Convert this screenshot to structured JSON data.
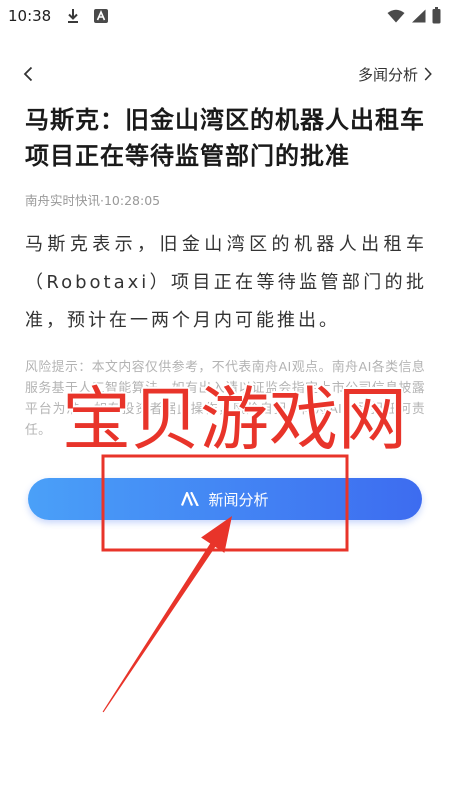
{
  "status_bar": {
    "time": "10:38",
    "left_icons": [
      "download-icon",
      "app-a-icon"
    ],
    "right_icons": [
      "wifi-icon",
      "signal-icon",
      "battery-icon"
    ]
  },
  "header": {
    "back_icon": "chevron-left-icon",
    "analysis_link": "多闻分析",
    "analysis_link_icon": "chevron-right-icon"
  },
  "article": {
    "title": "马斯克：旧金山湾区的机器人出租车项目正在等待监管部门的批准",
    "source_line": "南舟实时快讯·10:28:05",
    "body": "马斯克表示，旧金山湾区的机器人出租车（Robotaxi）项目正在等待监管部门的批准，预计在一两个月内可能推出。",
    "disclaimer": "风险提示：本文内容仅供参考，不代表南舟AI观点。南舟AI各类信息服务基于人工智能算法，如有出入请以证监会指定上市公司信息披露平台为准。如有投资者据此操作，风险自担，南舟AI不承担任何责任。"
  },
  "action_button": {
    "label": "新闻分析",
    "icon": "ai-logo-icon"
  },
  "watermark": {
    "text": "宝贝游戏网"
  },
  "colors": {
    "title": "#1a1a1a",
    "body": "#333333",
    "meta": "#999999",
    "disclaimer": "#b3b3b3",
    "button_gradient_start": "#4aa0f8",
    "button_gradient_end": "#3d6cf0",
    "annotation_red": "#e8342a"
  }
}
